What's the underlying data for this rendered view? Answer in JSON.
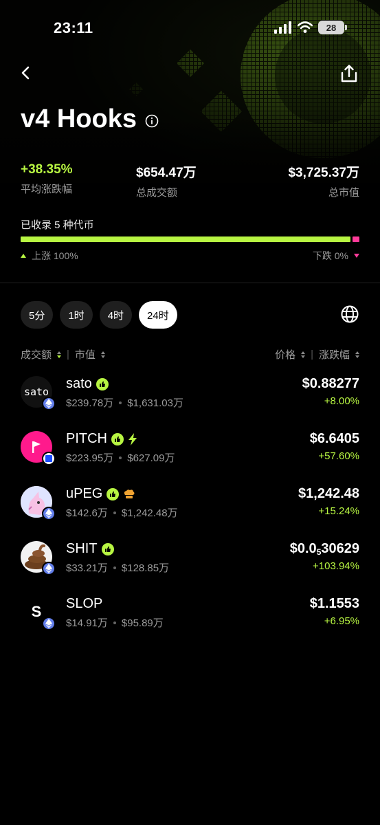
{
  "status": {
    "time": "23:11",
    "battery": "28"
  },
  "page": {
    "title": "v4 Hooks"
  },
  "stats": [
    {
      "value": "+38.35%",
      "label": "平均涨跌幅"
    },
    {
      "value": "$654.47万",
      "label": "总成交额"
    },
    {
      "value": "$3,725.37万",
      "label": "总市值"
    }
  ],
  "listed": "已收录 5 种代币",
  "ratio": {
    "up_fraction": 0.98,
    "up_label": "上涨 100%",
    "down_label": "下跌 0%",
    "up_color": "#b7f542",
    "down_color": "#ff3b9a"
  },
  "timeframes": [
    {
      "label": "5分",
      "active": false
    },
    {
      "label": "1时",
      "active": false
    },
    {
      "label": "4时",
      "active": false
    },
    {
      "label": "24时",
      "active": true
    }
  ],
  "sort": {
    "volume": "成交额",
    "mcap": "市值",
    "price": "价格",
    "change": "涨跌幅"
  },
  "tokens": [
    {
      "name": "sato",
      "volume": "$239.78万",
      "mcap": "$1,631.03万",
      "price": "$0.88277",
      "change": "+8.00%",
      "chain": "ethereum-icon",
      "avatar_text": "sato"
    },
    {
      "name": "PITCH",
      "volume": "$223.95万",
      "mcap": "$627.09万",
      "price": "$6.6405",
      "change": "+57.60%",
      "chain": "base-icon",
      "avatar_text": ""
    },
    {
      "name": "uPEG",
      "volume": "$142.6万",
      "mcap": "$1,242.48万",
      "price": "$1,242.48",
      "change": "+15.24%",
      "chain": "ethereum-icon",
      "avatar_text": ""
    },
    {
      "name": "SHIT",
      "volume": "$33.21万",
      "mcap": "$128.85万",
      "price_prefix": "$0.0",
      "price_sub": "5",
      "price_rest": "30629",
      "change": "+103.94%",
      "chain": "ethereum-icon",
      "avatar_text": ""
    },
    {
      "name": "SLOP",
      "volume": "$14.91万",
      "mcap": "$95.89万",
      "price": "$1.1553",
      "change": "+6.95%",
      "chain": "ethereum-icon",
      "avatar_text": "S"
    }
  ],
  "colors": {
    "accent": "#b7f542",
    "negative": "#ff3b9a",
    "muted": "#9a9a9a"
  }
}
